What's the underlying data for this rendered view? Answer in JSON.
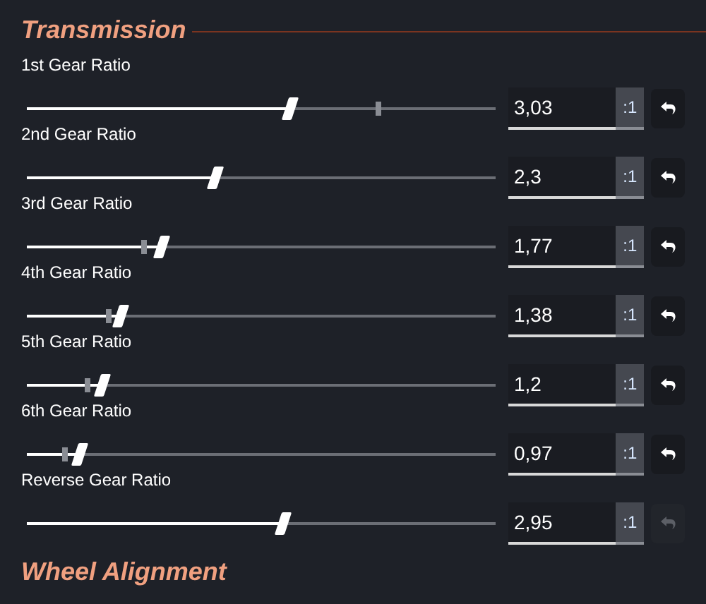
{
  "section_title": "Transmission",
  "gears": [
    {
      "label": "1st Gear Ratio",
      "level": 0.56,
      "default_marker": {
        "level": 0.75
      },
      "value": "3,03",
      "unit": ":1",
      "reset_disabled": false
    },
    {
      "label": "2nd Gear Ratio",
      "level": 0.4,
      "value": "2,3",
      "unit": ":1",
      "reset_disabled": false
    },
    {
      "label": "3rd Gear Ratio",
      "level": 0.285,
      "default_marker": {
        "level": 0.25
      },
      "value": "1,77",
      "unit": ":1",
      "reset_disabled": false
    },
    {
      "label": "4th Gear Ratio",
      "level": 0.2,
      "default_marker": {
        "level": 0.175
      },
      "value": "1,38",
      "unit": ":1",
      "reset_disabled": false
    },
    {
      "label": "5th Gear Ratio",
      "level": 0.16,
      "default_marker": {
        "level": 0.13
      },
      "value": "1,2",
      "unit": ":1",
      "reset_disabled": false
    },
    {
      "label": "6th Gear Ratio",
      "level": 0.11,
      "default_marker": {
        "level": 0.08
      },
      "value": "0,97",
      "unit": ":1",
      "reset_disabled": false
    },
    {
      "label": "Reverse Gear Ratio",
      "level": 0.545,
      "value": "2,95",
      "unit": ":1",
      "reset_disabled": true
    }
  ],
  "next_section_title": "Wheel Alignment"
}
